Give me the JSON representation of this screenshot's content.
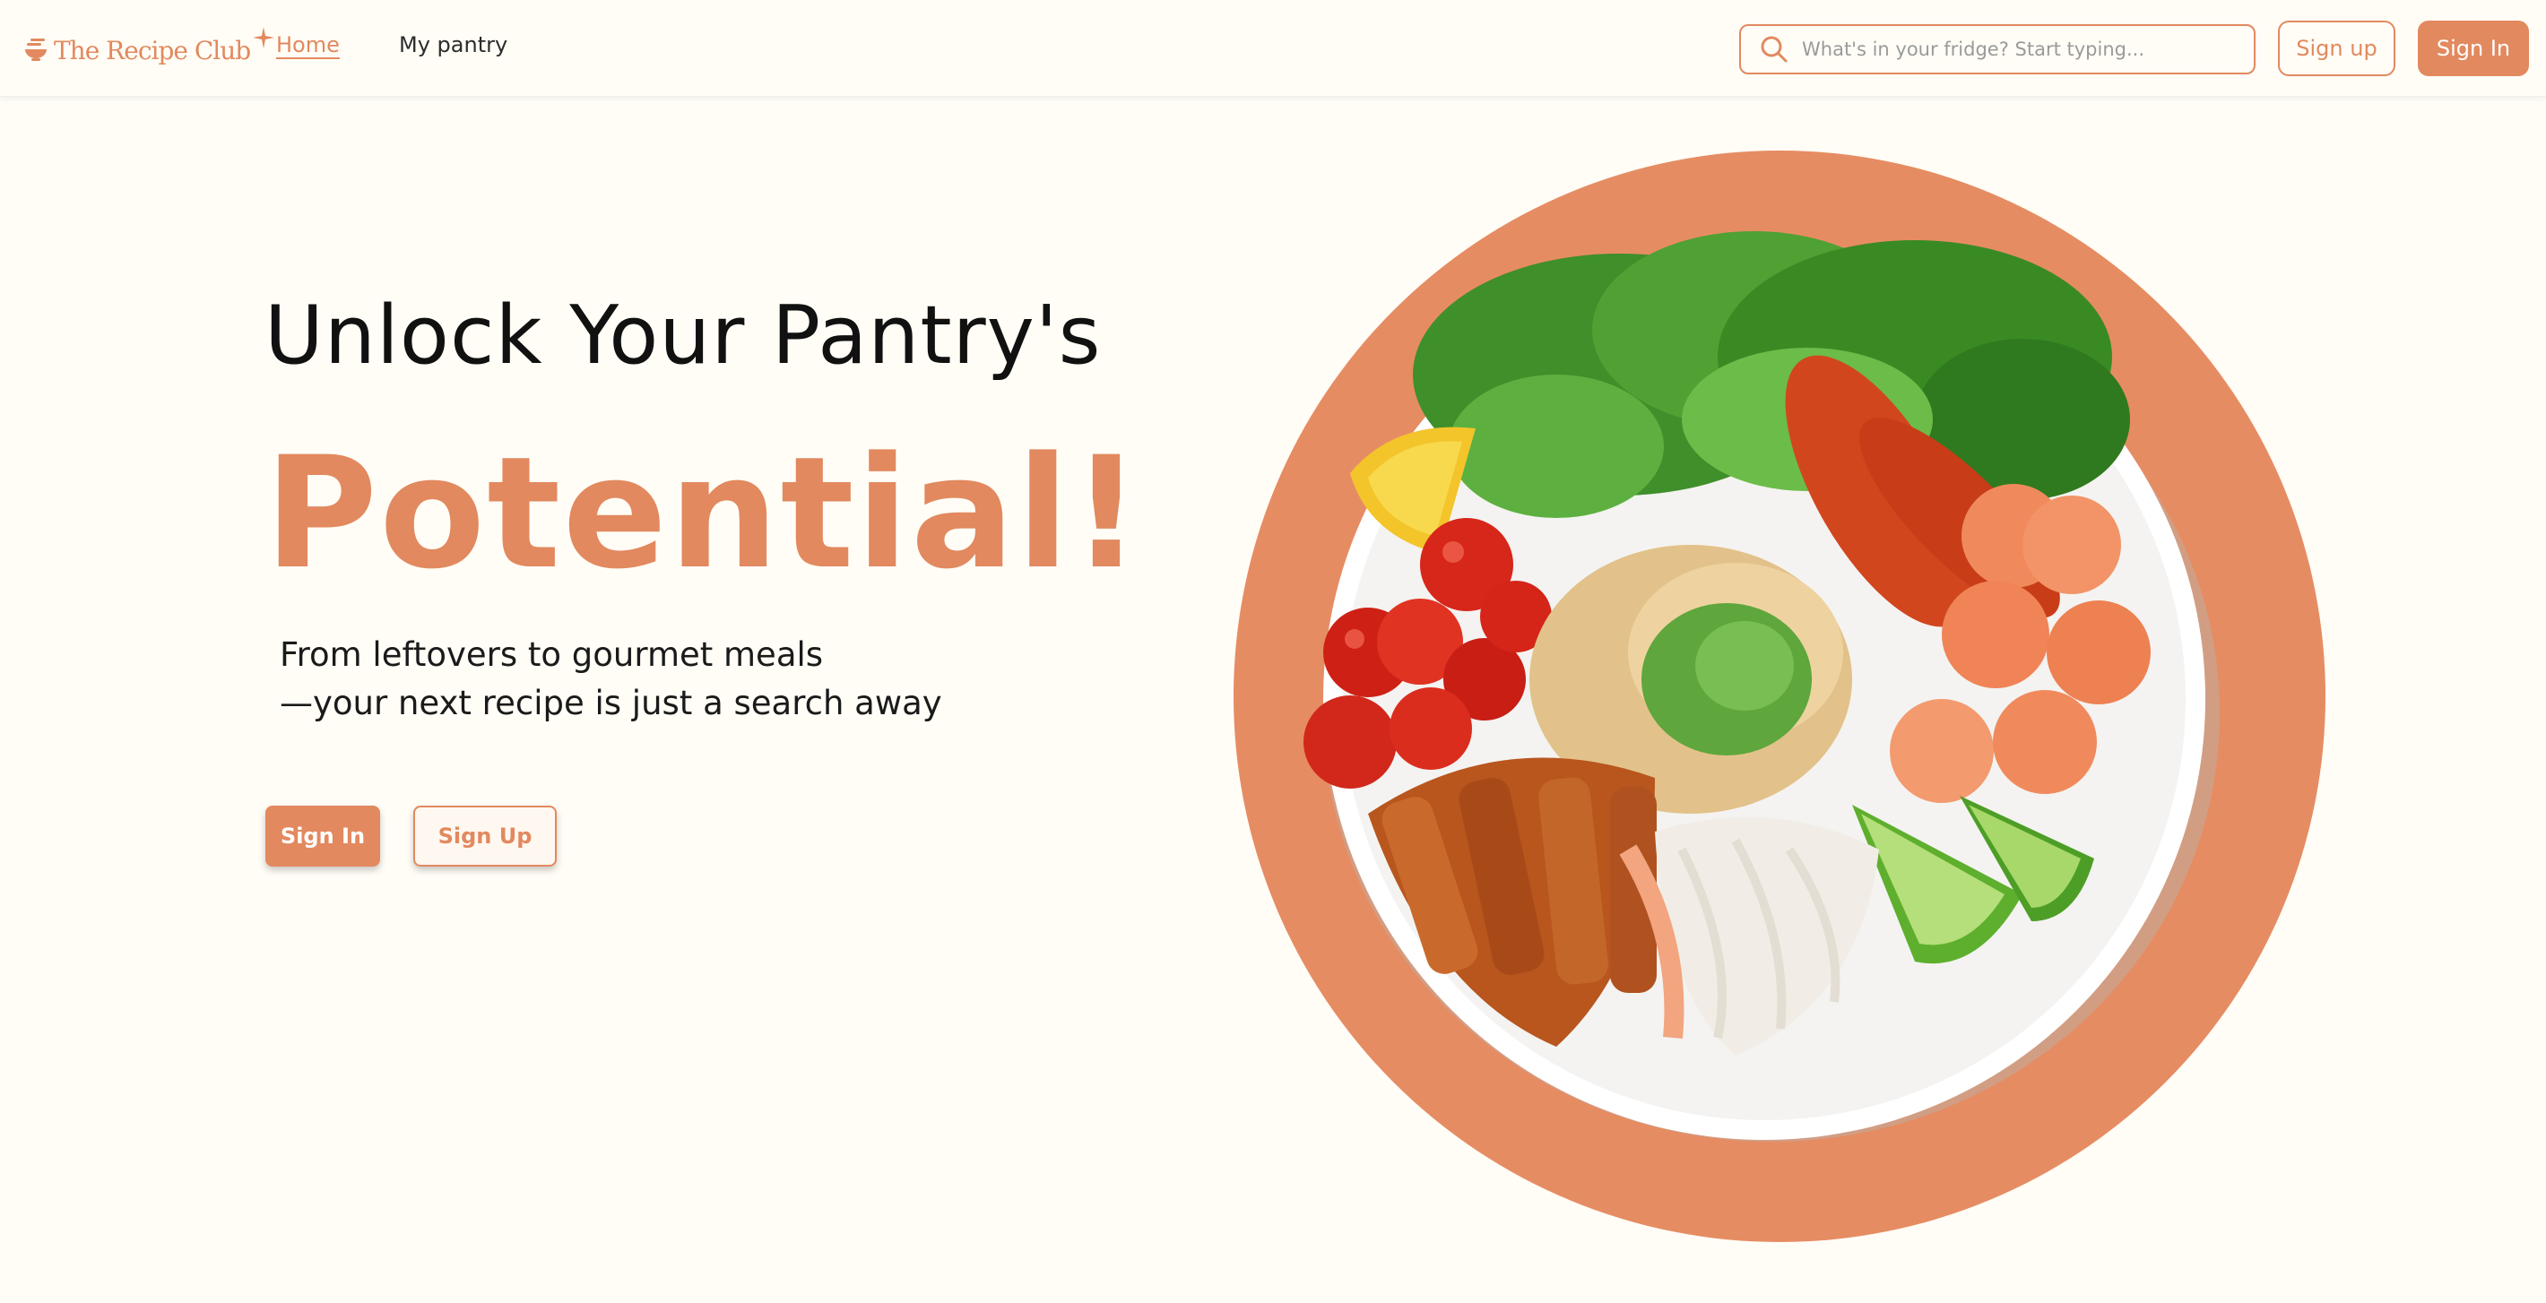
{
  "brand": {
    "name": "The Recipe Club",
    "accent_color": "#E2895F",
    "background_color": "#FFFDF6"
  },
  "nav": {
    "home_label": "Home",
    "pantry_label": "My pantry"
  },
  "search": {
    "placeholder": "What's in your fridge? Start typing...",
    "value": "",
    "icon": "search-icon"
  },
  "header_actions": {
    "signup_label": "Sign up",
    "signin_label": "Sign In"
  },
  "hero": {
    "title": "Unlock Your Pantry's",
    "accent": "Potential!",
    "subtitle_line1": "From leftovers to gourmet meals",
    "subtitle_line2": "—your next recipe is just a search away",
    "signin_label": "Sign In",
    "signup_label": "Sign Up",
    "image_subject": "plate-with-salad-shrimp-rice-noodles"
  }
}
